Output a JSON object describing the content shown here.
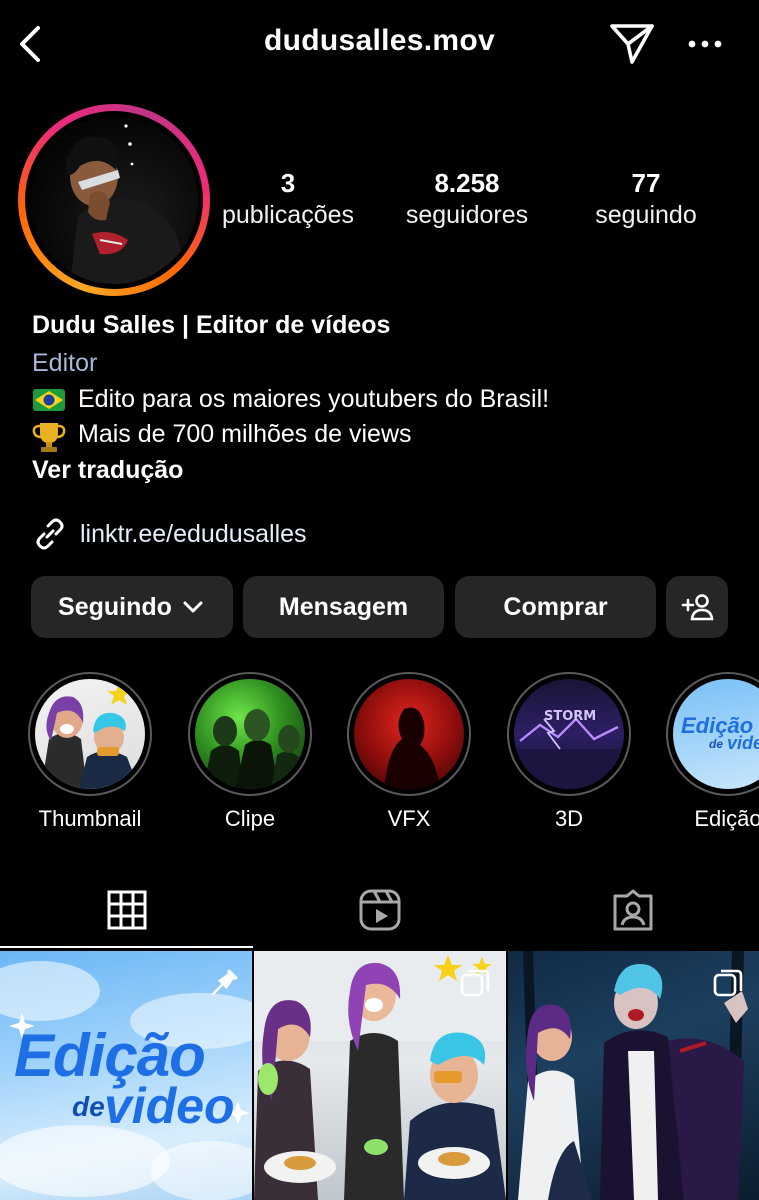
{
  "header": {
    "username": "dudusalles.mov",
    "back_icon": "chevron-left-icon",
    "send_icon": "paper-plane-icon",
    "more_icon": "ellipsis-icon"
  },
  "profile": {
    "stats": [
      {
        "value": "3",
        "label": "publicações"
      },
      {
        "value": "8.258",
        "label": "seguidores"
      },
      {
        "value": "77",
        "label": "seguindo"
      }
    ],
    "display_name": "Dudu Salles | Editor de vídeos",
    "category": "Editor",
    "bio_lines": [
      {
        "icon": "brazil-flag-icon",
        "text": "Edito para os maiores youtubers do Brasil!"
      },
      {
        "icon": "trophy-icon",
        "text": "Mais de 700 milhões de views"
      }
    ],
    "see_translation": "Ver tradução",
    "link": "linktr.ee/edudusalles"
  },
  "actions": {
    "following_label": "Seguindo",
    "message_label": "Mensagem",
    "buy_label": "Comprar"
  },
  "highlights": [
    {
      "label": "Thumbnail"
    },
    {
      "label": "Clipe"
    },
    {
      "label": "VFX"
    },
    {
      "label": "3D"
    },
    {
      "label": "Edição"
    }
  ],
  "highlight_art": {
    "storm_text": "STORM",
    "edicao_word": "Edição",
    "de_word": "de",
    "video_word": "video"
  },
  "tabs": [
    {
      "name": "grid",
      "icon": "grid-icon",
      "active": true
    },
    {
      "name": "reels",
      "icon": "reels-icon",
      "active": false
    },
    {
      "name": "tagged",
      "icon": "tagged-icon",
      "active": false
    }
  ],
  "posts": {
    "post1": {
      "title_line1": "Edição",
      "title_line2a": "de",
      "title_line2b": "video",
      "badge": "pin-icon"
    },
    "post2": {
      "badge": "carousel-icon"
    },
    "post3": {
      "badge": "carousel-icon"
    }
  },
  "colors": {
    "background": "#000000",
    "button_bg": "#262626",
    "category_text": "#a5b8d6",
    "ring_gradient": [
      "#f9a825",
      "#ee2a7b",
      "#c13584"
    ]
  }
}
